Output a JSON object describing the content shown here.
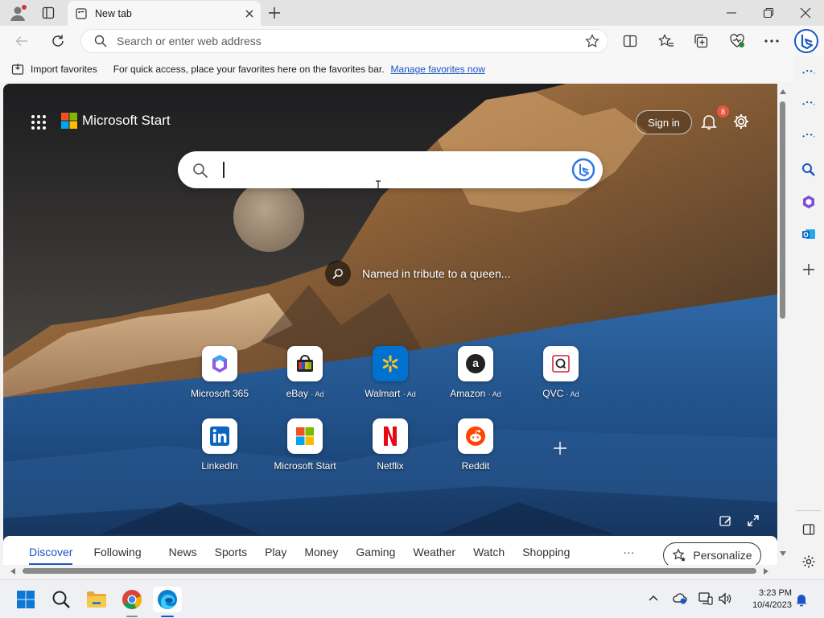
{
  "browser": {
    "tab_title": "New tab",
    "address_placeholder": "Search or enter web address"
  },
  "favorites_bar": {
    "import_label": "Import favorites",
    "hint": "For quick access, place your favorites here on the favorites bar.",
    "manage_link": "Manage favorites now"
  },
  "start_page": {
    "brand": "Microsoft Start",
    "sign_in": "Sign in",
    "notification_count": "8",
    "image_caption": "Named in tribute to a queen...",
    "tiles": [
      {
        "label": "Microsoft 365",
        "ad": "",
        "icon": "microsoft-365-icon"
      },
      {
        "label": "eBay",
        "ad": "Ad",
        "icon": "ebay-icon"
      },
      {
        "label": "Walmart",
        "ad": "Ad",
        "icon": "walmart-icon"
      },
      {
        "label": "Amazon",
        "ad": "Ad",
        "icon": "amazon-icon"
      },
      {
        "label": "QVC",
        "ad": "Ad",
        "icon": "qvc-icon"
      },
      {
        "label": "LinkedIn",
        "ad": "",
        "icon": "linkedin-icon"
      },
      {
        "label": "Microsoft Start",
        "ad": "",
        "icon": "microsoft-start-icon"
      },
      {
        "label": "Netflix",
        "ad": "",
        "icon": "netflix-icon"
      },
      {
        "label": "Reddit",
        "ad": "",
        "icon": "reddit-icon"
      }
    ],
    "feed_tabs": [
      "Discover",
      "Following",
      "News",
      "Sports",
      "Play",
      "Money",
      "Gaming",
      "Weather",
      "Watch",
      "Shopping"
    ],
    "feed_more": "···",
    "personalize": "Personalize"
  },
  "taskbar": {
    "time": "3:23 PM",
    "date": "10/4/2023"
  },
  "colors": {
    "accent": "#1a55c3",
    "notification_badge": "#e8563f"
  }
}
